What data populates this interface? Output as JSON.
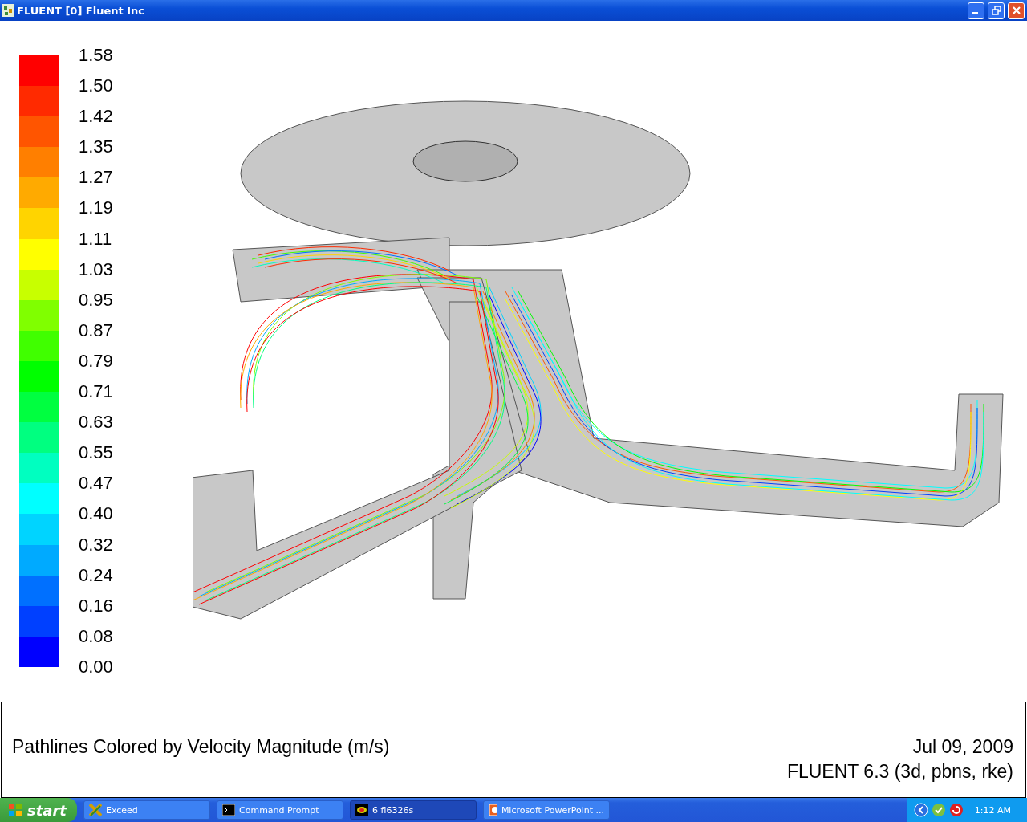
{
  "window": {
    "title": "FLUENT [0] Fluent Inc"
  },
  "legend": {
    "swatches": [
      {
        "color": "#ff0000"
      },
      {
        "color": "#ff2a00"
      },
      {
        "color": "#ff5500"
      },
      {
        "color": "#ff7f00"
      },
      {
        "color": "#ffaa00"
      },
      {
        "color": "#ffd400"
      },
      {
        "color": "#ffff00"
      },
      {
        "color": "#c8ff00"
      },
      {
        "color": "#80ff00"
      },
      {
        "color": "#40ff00"
      },
      {
        "color": "#00ff00"
      },
      {
        "color": "#00ff40"
      },
      {
        "color": "#00ff80"
      },
      {
        "color": "#00ffc0"
      },
      {
        "color": "#00ffff"
      },
      {
        "color": "#00d4ff"
      },
      {
        "color": "#00aaff"
      },
      {
        "color": "#0070ff"
      },
      {
        "color": "#0040ff"
      },
      {
        "color": "#0000ff"
      }
    ],
    "labels": [
      "1.58",
      "1.50",
      "1.42",
      "1.35",
      "1.27",
      "1.19",
      "1.11",
      "1.03",
      "0.95",
      "0.87",
      "0.79",
      "0.71",
      "0.63",
      "0.55",
      "0.47",
      "0.40",
      "0.32",
      "0.24",
      "0.16",
      "0.08",
      "0.00"
    ]
  },
  "caption": {
    "title": "Pathlines Colored by Velocity Magnitude (m/s)",
    "date": "Jul 09, 2009",
    "version": "FLUENT 6.3 (3d, pbns, rke)"
  },
  "taskbar": {
    "start": "start",
    "tasks": [
      {
        "label": "Exceed",
        "kind": "exceed",
        "selected": false
      },
      {
        "label": "Command Prompt",
        "kind": "cmd",
        "selected": false
      },
      {
        "label": "6  fl6326s",
        "kind": "fluent",
        "selected": true
      },
      {
        "label": "Microsoft PowerPoint ...",
        "kind": "ppt",
        "selected": false
      }
    ],
    "clock": "1:12 AM"
  }
}
